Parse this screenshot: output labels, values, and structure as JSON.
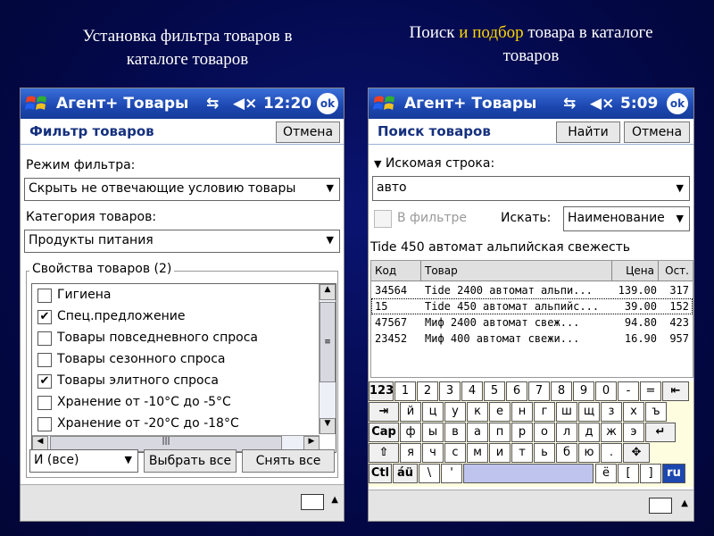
{
  "captions": {
    "left": {
      "line1": "Установка фильтра  товаров в",
      "line2": "каталоге товаров"
    },
    "right": {
      "line1a": "Поиск ",
      "line1b": "и подбор",
      "line1c": " товара в каталоге",
      "line2": "товаров"
    }
  },
  "colors": {
    "background": "#030848",
    "title_bar": "#1c47b0",
    "caption_highlight": "#ffd700",
    "header_text": "#15307e",
    "keyboard_bg": "#fffde0"
  },
  "left_device": {
    "app_title": "Агент+ Товары",
    "clock": "12:20",
    "ok_label": "ok",
    "header_title": "Фильтр товаров",
    "cancel_label": "Отмена",
    "filter_mode_label": "Режим фильтра:",
    "filter_mode_value": "Скрыть не отвечающие условию товары",
    "category_label": "Категория товаров:",
    "category_value": "Продукты питания",
    "properties_legend": "Свойства товаров (2)",
    "properties": [
      {
        "label": "Гигиена",
        "checked": false
      },
      {
        "label": "Спец.предложение",
        "checked": true
      },
      {
        "label": "Товары повседневного спроса",
        "checked": false
      },
      {
        "label": "Товары сезонного спроса",
        "checked": false
      },
      {
        "label": "Товары элитного спроса",
        "checked": true
      },
      {
        "label": "Хранение от -10°С до -5°С",
        "checked": false
      },
      {
        "label": "Хранение от -20°С до -18°С",
        "checked": false
      }
    ],
    "logic_value": "И (все)",
    "select_all_label": "Выбрать все",
    "clear_all_label": "Снять все"
  },
  "right_device": {
    "app_title": "Агент+ Товары",
    "clock": "5:09",
    "ok_label": "ok",
    "header_title": "Поиск товаров",
    "find_label": "Найти",
    "cancel_label": "Отмена",
    "search_string_label": "Искомая строка:",
    "search_value": "авто",
    "in_filter_label": "В фильтре",
    "search_by_label": "Искать:",
    "search_by_value": "Наименование",
    "selected_item": "Tide 450 автомат альпийская свежесть",
    "columns": [
      "Код",
      "Товар",
      "Цена",
      "Ост."
    ],
    "rows": [
      {
        "code": "34564",
        "name": "Tide 2400 автомат альпи...",
        "price": "139.00",
        "stock": "317"
      },
      {
        "code": "15",
        "name": "Tide 450 автомат альпийс...",
        "price": "39.00",
        "stock": "152"
      },
      {
        "code": "47567",
        "name": "Миф 2400 автомат свеж...",
        "price": "94.80",
        "stock": "423"
      },
      {
        "code": "23452",
        "name": "Миф 400 автомат свежи...",
        "price": "16.90",
        "stock": "957"
      }
    ],
    "keyboard": {
      "row1": [
        "123",
        "1",
        "2",
        "3",
        "4",
        "5",
        "6",
        "7",
        "8",
        "9",
        "0",
        "-",
        "=",
        "⇤"
      ],
      "row2": [
        "⇥",
        "й",
        "ц",
        "у",
        "к",
        "е",
        "н",
        "г",
        "ш",
        "щ",
        "з",
        "х",
        "ъ"
      ],
      "row3": [
        "Cap",
        "ф",
        "ы",
        "в",
        "а",
        "п",
        "р",
        "о",
        "л",
        "д",
        "ж",
        "э",
        "↵"
      ],
      "row4": [
        "⇧",
        "я",
        "ч",
        "с",
        "м",
        "и",
        "т",
        "ь",
        "б",
        "ю",
        ".",
        "✥"
      ],
      "row5": [
        "Ctl",
        "áü",
        "\\",
        "'",
        "ё",
        "[",
        "]",
        "ru"
      ]
    }
  }
}
